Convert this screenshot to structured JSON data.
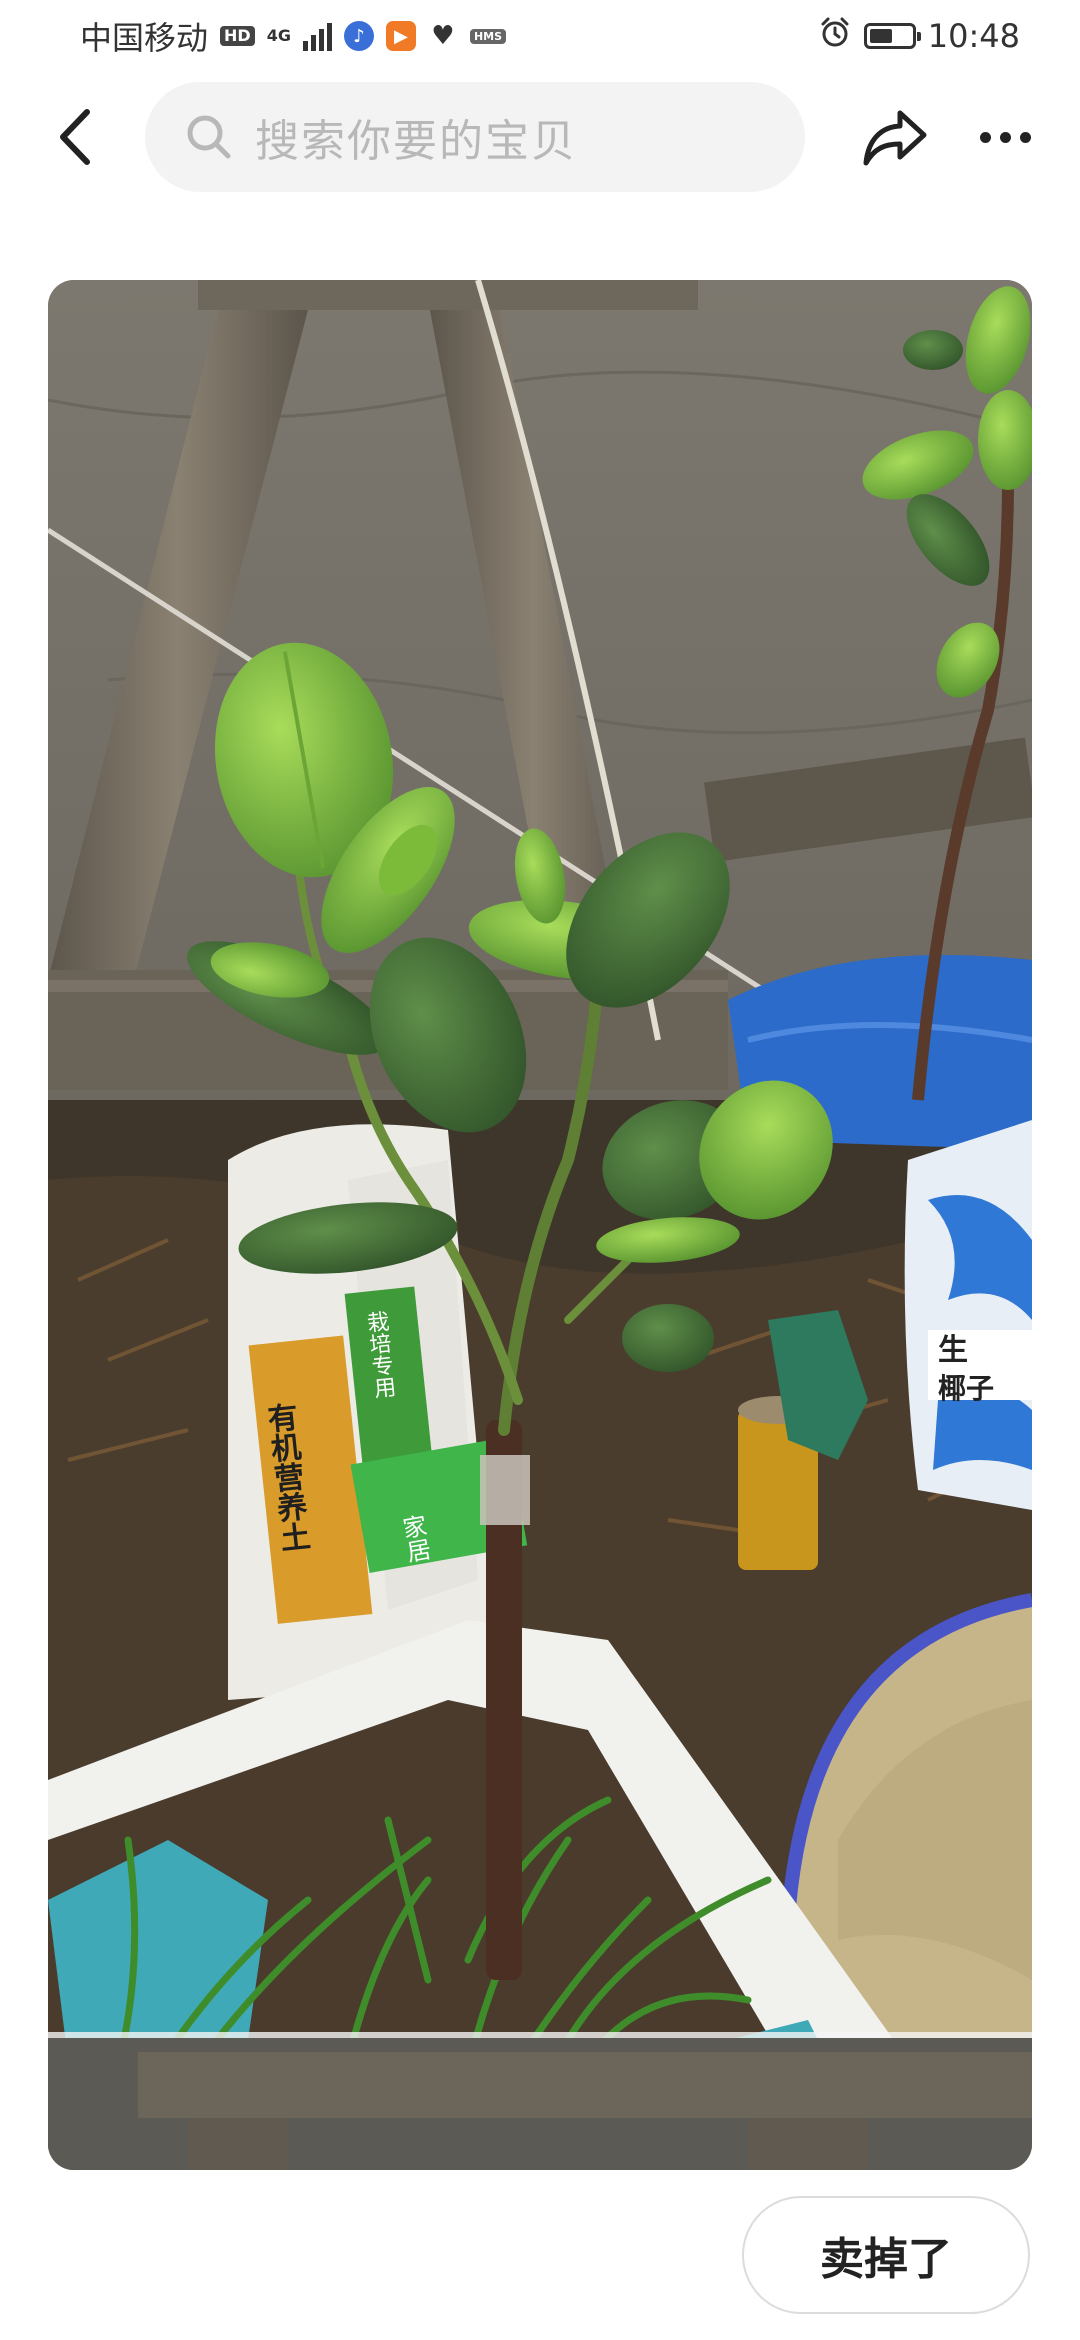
{
  "status_bar": {
    "carrier": "中国移动",
    "hd_badge": "HD",
    "network": "4G",
    "hms_badge": "HMS",
    "time": "10:48",
    "battery_level": 0.55,
    "icons": [
      "alarm-icon",
      "battery-icon",
      "music-app-icon",
      "video-app-icon",
      "health-app-icon"
    ]
  },
  "search": {
    "placeholder": "搜索你要的宝贝"
  },
  "product": {
    "photo_subject": "potted-sapling"
  },
  "actions": {
    "sold_label": "卖掉了"
  },
  "photo_text": {
    "bag_label_vertical": "有机营养土",
    "bag_side_label": "栽培专用",
    "bag_green_label": "家居",
    "soil_bag_label_1": "生",
    "soil_bag_label_2": "椰子"
  },
  "colors": {
    "accent": "#222222",
    "search_bg": "#f3f3f3",
    "placeholder": "#b8b8b8"
  }
}
